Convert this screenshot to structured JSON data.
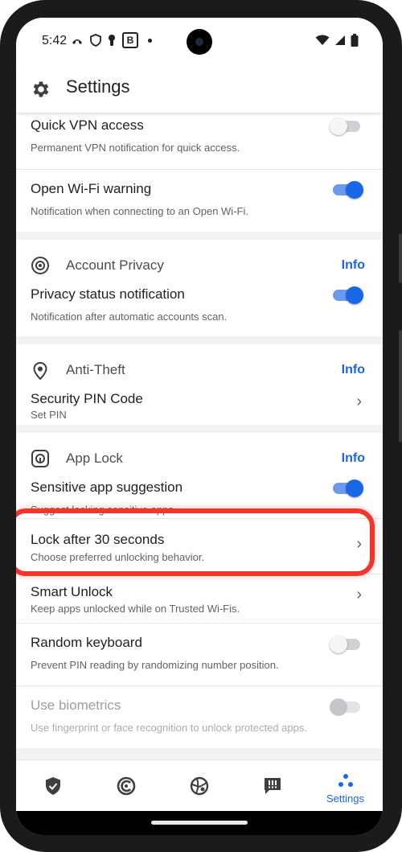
{
  "status_bar": {
    "time": "5:42",
    "b_label": "B"
  },
  "header": {
    "title": "Settings"
  },
  "sections": {
    "vpn": {
      "rows": [
        {
          "title": "Quick VPN access",
          "subtitle": "Permanent VPN notification for quick access.",
          "toggle": "off"
        },
        {
          "title": "Open Wi-Fi warning",
          "subtitle": "Notification when connecting to an Open Wi-Fi.",
          "toggle": "on"
        }
      ]
    },
    "account_privacy": {
      "title": "Account Privacy",
      "info": "Info",
      "rows": [
        {
          "title": "Privacy status notification",
          "subtitle": "Notification after automatic accounts scan.",
          "toggle": "on"
        }
      ]
    },
    "anti_theft": {
      "title": "Anti-Theft",
      "info": "Info",
      "rows": [
        {
          "title": "Security PIN Code",
          "subtitle": "Set PIN"
        }
      ]
    },
    "app_lock": {
      "title": "App Lock",
      "info": "Info",
      "rows": [
        {
          "title": "Sensitive app suggestion",
          "subtitle": "Suggest locking sensitive apps.",
          "toggle": "on"
        },
        {
          "title": "Lock after 30 seconds",
          "subtitle": "Choose preferred unlocking behavior."
        },
        {
          "title": "Smart Unlock",
          "subtitle": "Keep apps unlocked while on Trusted Wi-Fis."
        },
        {
          "title": "Random keyboard",
          "subtitle": "Prevent PIN reading by randomizing number position.",
          "toggle": "off"
        },
        {
          "title": "Use biometrics",
          "subtitle": "Use fingerprint or face recognition to unlock protected apps.",
          "toggle": "disabled"
        }
      ]
    }
  },
  "bottom_nav": {
    "items": [
      {
        "icon": "shield-check-icon"
      },
      {
        "icon": "privacy-icon"
      },
      {
        "icon": "web-protection-icon"
      },
      {
        "icon": "alerts-icon"
      },
      {
        "icon": "settings-dots-icon",
        "label": "Settings",
        "active": true
      }
    ]
  },
  "colors": {
    "accent": "#1a66e8",
    "highlight": "#f2372a",
    "background": "#f1f2f4"
  }
}
